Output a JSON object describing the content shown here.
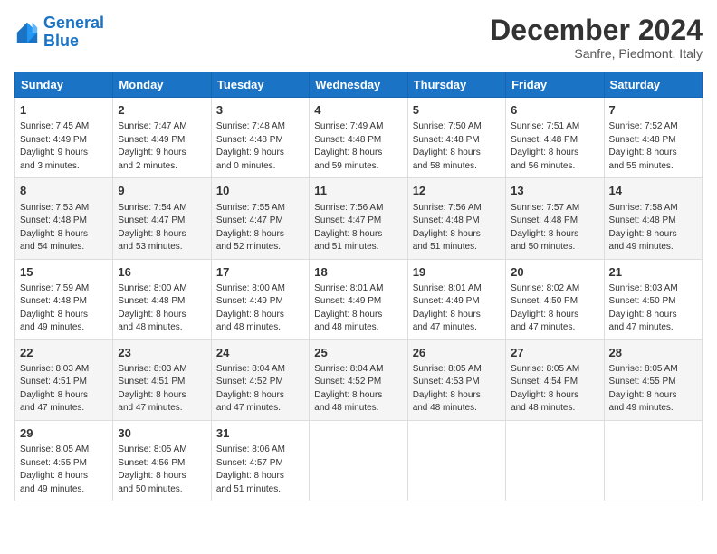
{
  "logo": {
    "line1": "General",
    "line2": "Blue"
  },
  "title": "December 2024",
  "subtitle": "Sanfre, Piedmont, Italy",
  "weekdays": [
    "Sunday",
    "Monday",
    "Tuesday",
    "Wednesday",
    "Thursday",
    "Friday",
    "Saturday"
  ],
  "weeks": [
    [
      {
        "day": "1",
        "info": "Sunrise: 7:45 AM\nSunset: 4:49 PM\nDaylight: 9 hours\nand 3 minutes."
      },
      {
        "day": "2",
        "info": "Sunrise: 7:47 AM\nSunset: 4:49 PM\nDaylight: 9 hours\nand 2 minutes."
      },
      {
        "day": "3",
        "info": "Sunrise: 7:48 AM\nSunset: 4:48 PM\nDaylight: 9 hours\nand 0 minutes."
      },
      {
        "day": "4",
        "info": "Sunrise: 7:49 AM\nSunset: 4:48 PM\nDaylight: 8 hours\nand 59 minutes."
      },
      {
        "day": "5",
        "info": "Sunrise: 7:50 AM\nSunset: 4:48 PM\nDaylight: 8 hours\nand 58 minutes."
      },
      {
        "day": "6",
        "info": "Sunrise: 7:51 AM\nSunset: 4:48 PM\nDaylight: 8 hours\nand 56 minutes."
      },
      {
        "day": "7",
        "info": "Sunrise: 7:52 AM\nSunset: 4:48 PM\nDaylight: 8 hours\nand 55 minutes."
      }
    ],
    [
      {
        "day": "8",
        "info": "Sunrise: 7:53 AM\nSunset: 4:48 PM\nDaylight: 8 hours\nand 54 minutes."
      },
      {
        "day": "9",
        "info": "Sunrise: 7:54 AM\nSunset: 4:47 PM\nDaylight: 8 hours\nand 53 minutes."
      },
      {
        "day": "10",
        "info": "Sunrise: 7:55 AM\nSunset: 4:47 PM\nDaylight: 8 hours\nand 52 minutes."
      },
      {
        "day": "11",
        "info": "Sunrise: 7:56 AM\nSunset: 4:47 PM\nDaylight: 8 hours\nand 51 minutes."
      },
      {
        "day": "12",
        "info": "Sunrise: 7:56 AM\nSunset: 4:48 PM\nDaylight: 8 hours\nand 51 minutes."
      },
      {
        "day": "13",
        "info": "Sunrise: 7:57 AM\nSunset: 4:48 PM\nDaylight: 8 hours\nand 50 minutes."
      },
      {
        "day": "14",
        "info": "Sunrise: 7:58 AM\nSunset: 4:48 PM\nDaylight: 8 hours\nand 49 minutes."
      }
    ],
    [
      {
        "day": "15",
        "info": "Sunrise: 7:59 AM\nSunset: 4:48 PM\nDaylight: 8 hours\nand 49 minutes."
      },
      {
        "day": "16",
        "info": "Sunrise: 8:00 AM\nSunset: 4:48 PM\nDaylight: 8 hours\nand 48 minutes."
      },
      {
        "day": "17",
        "info": "Sunrise: 8:00 AM\nSunset: 4:49 PM\nDaylight: 8 hours\nand 48 minutes."
      },
      {
        "day": "18",
        "info": "Sunrise: 8:01 AM\nSunset: 4:49 PM\nDaylight: 8 hours\nand 48 minutes."
      },
      {
        "day": "19",
        "info": "Sunrise: 8:01 AM\nSunset: 4:49 PM\nDaylight: 8 hours\nand 47 minutes."
      },
      {
        "day": "20",
        "info": "Sunrise: 8:02 AM\nSunset: 4:50 PM\nDaylight: 8 hours\nand 47 minutes."
      },
      {
        "day": "21",
        "info": "Sunrise: 8:03 AM\nSunset: 4:50 PM\nDaylight: 8 hours\nand 47 minutes."
      }
    ],
    [
      {
        "day": "22",
        "info": "Sunrise: 8:03 AM\nSunset: 4:51 PM\nDaylight: 8 hours\nand 47 minutes."
      },
      {
        "day": "23",
        "info": "Sunrise: 8:03 AM\nSunset: 4:51 PM\nDaylight: 8 hours\nand 47 minutes."
      },
      {
        "day": "24",
        "info": "Sunrise: 8:04 AM\nSunset: 4:52 PM\nDaylight: 8 hours\nand 47 minutes."
      },
      {
        "day": "25",
        "info": "Sunrise: 8:04 AM\nSunset: 4:52 PM\nDaylight: 8 hours\nand 48 minutes."
      },
      {
        "day": "26",
        "info": "Sunrise: 8:05 AM\nSunset: 4:53 PM\nDaylight: 8 hours\nand 48 minutes."
      },
      {
        "day": "27",
        "info": "Sunrise: 8:05 AM\nSunset: 4:54 PM\nDaylight: 8 hours\nand 48 minutes."
      },
      {
        "day": "28",
        "info": "Sunrise: 8:05 AM\nSunset: 4:55 PM\nDaylight: 8 hours\nand 49 minutes."
      }
    ],
    [
      {
        "day": "29",
        "info": "Sunrise: 8:05 AM\nSunset: 4:55 PM\nDaylight: 8 hours\nand 49 minutes."
      },
      {
        "day": "30",
        "info": "Sunrise: 8:05 AM\nSunset: 4:56 PM\nDaylight: 8 hours\nand 50 minutes."
      },
      {
        "day": "31",
        "info": "Sunrise: 8:06 AM\nSunset: 4:57 PM\nDaylight: 8 hours\nand 51 minutes."
      },
      null,
      null,
      null,
      null
    ]
  ]
}
